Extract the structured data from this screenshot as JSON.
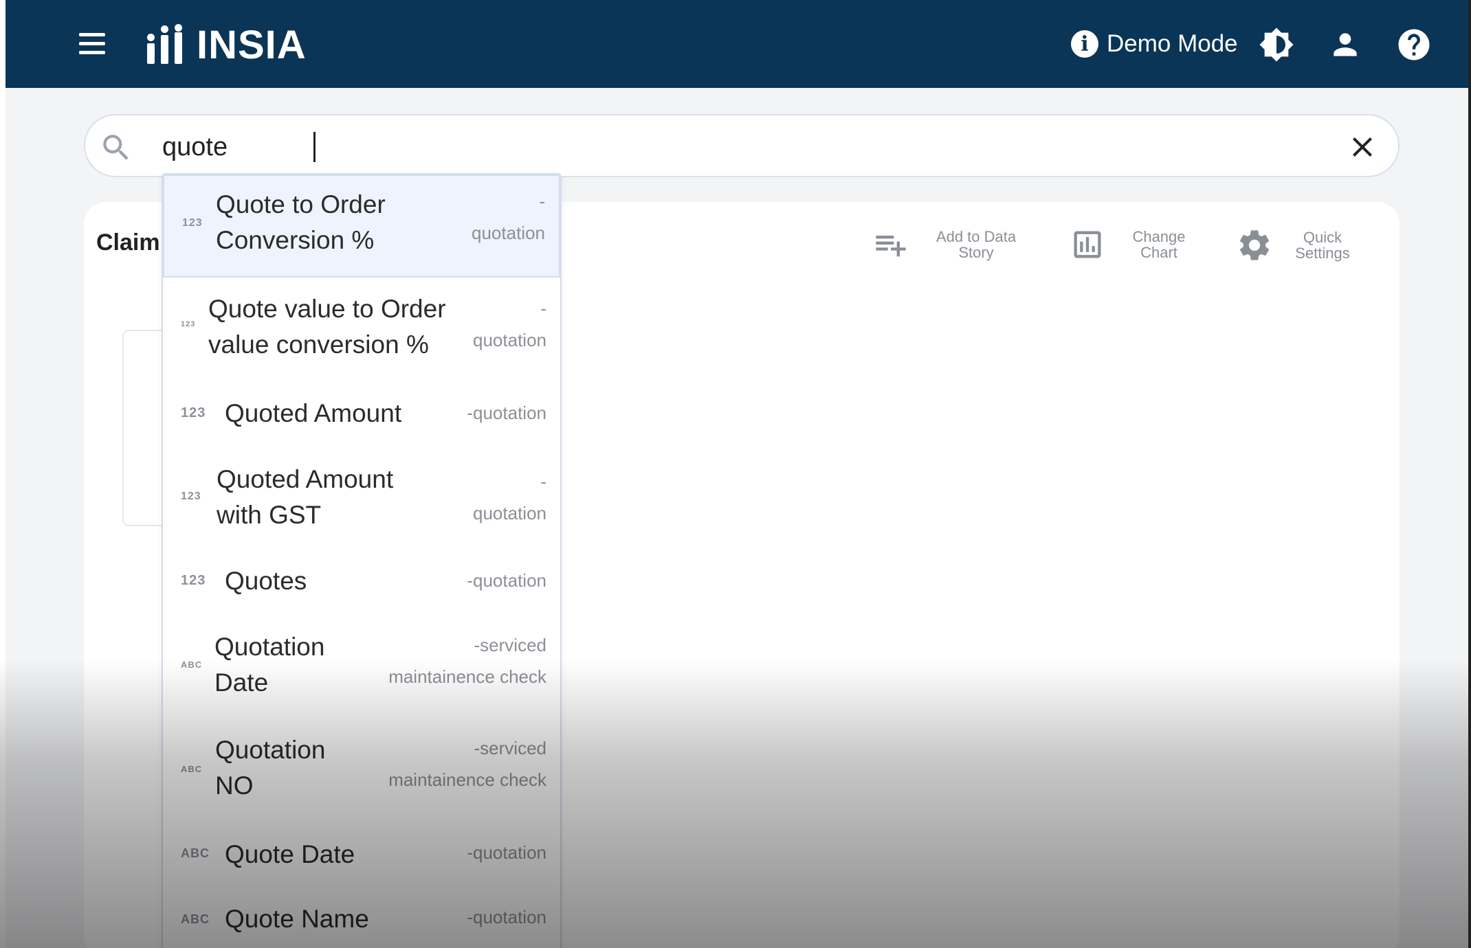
{
  "app": {
    "name": "INSIA"
  },
  "header": {
    "demo_mode_label": "Demo Mode",
    "icons": [
      "menu-icon",
      "info-icon",
      "theme-icon",
      "user-icon",
      "help-icon"
    ],
    "color": "#0b3556"
  },
  "search": {
    "value": "quote",
    "placeholder": ""
  },
  "card": {
    "title": "Claim",
    "tools": [
      {
        "label": "Add to Data Story",
        "icon": "playlist-add-icon"
      },
      {
        "label": "Change Chart",
        "icon": "bar-chart-icon"
      },
      {
        "label": "Quick Settings",
        "icon": "gear-icon"
      }
    ]
  },
  "suggestions": [
    {
      "type": "123",
      "label_lines": [
        "Quote to Order",
        "Conversion %"
      ],
      "source_lines": [
        "-",
        "quotation"
      ]
    },
    {
      "type": "123",
      "label_lines": [
        "Quote value to Order",
        "value conversion %"
      ],
      "source_lines": [
        "-",
        "quotation"
      ]
    },
    {
      "type": "123",
      "label_lines": [
        "Quoted Amount"
      ],
      "source_lines": [
        "-quotation"
      ]
    },
    {
      "type": "123",
      "label_lines": [
        "Quoted Amount",
        "with GST"
      ],
      "source_lines": [
        "-",
        "quotation"
      ]
    },
    {
      "type": "123",
      "label_lines": [
        "Quotes"
      ],
      "source_lines": [
        "-quotation"
      ]
    },
    {
      "type": "ABC",
      "label_lines": [
        "Quotation",
        "Date"
      ],
      "source_lines": [
        "-serviced",
        "maintainence check"
      ]
    },
    {
      "type": "ABC",
      "label_lines": [
        "Quotation",
        "NO"
      ],
      "source_lines": [
        "-serviced",
        "maintainence check"
      ]
    },
    {
      "type": "ABC",
      "label_lines": [
        "Quote Date"
      ],
      "source_lines": [
        "-quotation"
      ]
    },
    {
      "type": "ABC",
      "label_lines": [
        "Quote Name"
      ],
      "source_lines": [
        "-quotation"
      ]
    }
  ]
}
